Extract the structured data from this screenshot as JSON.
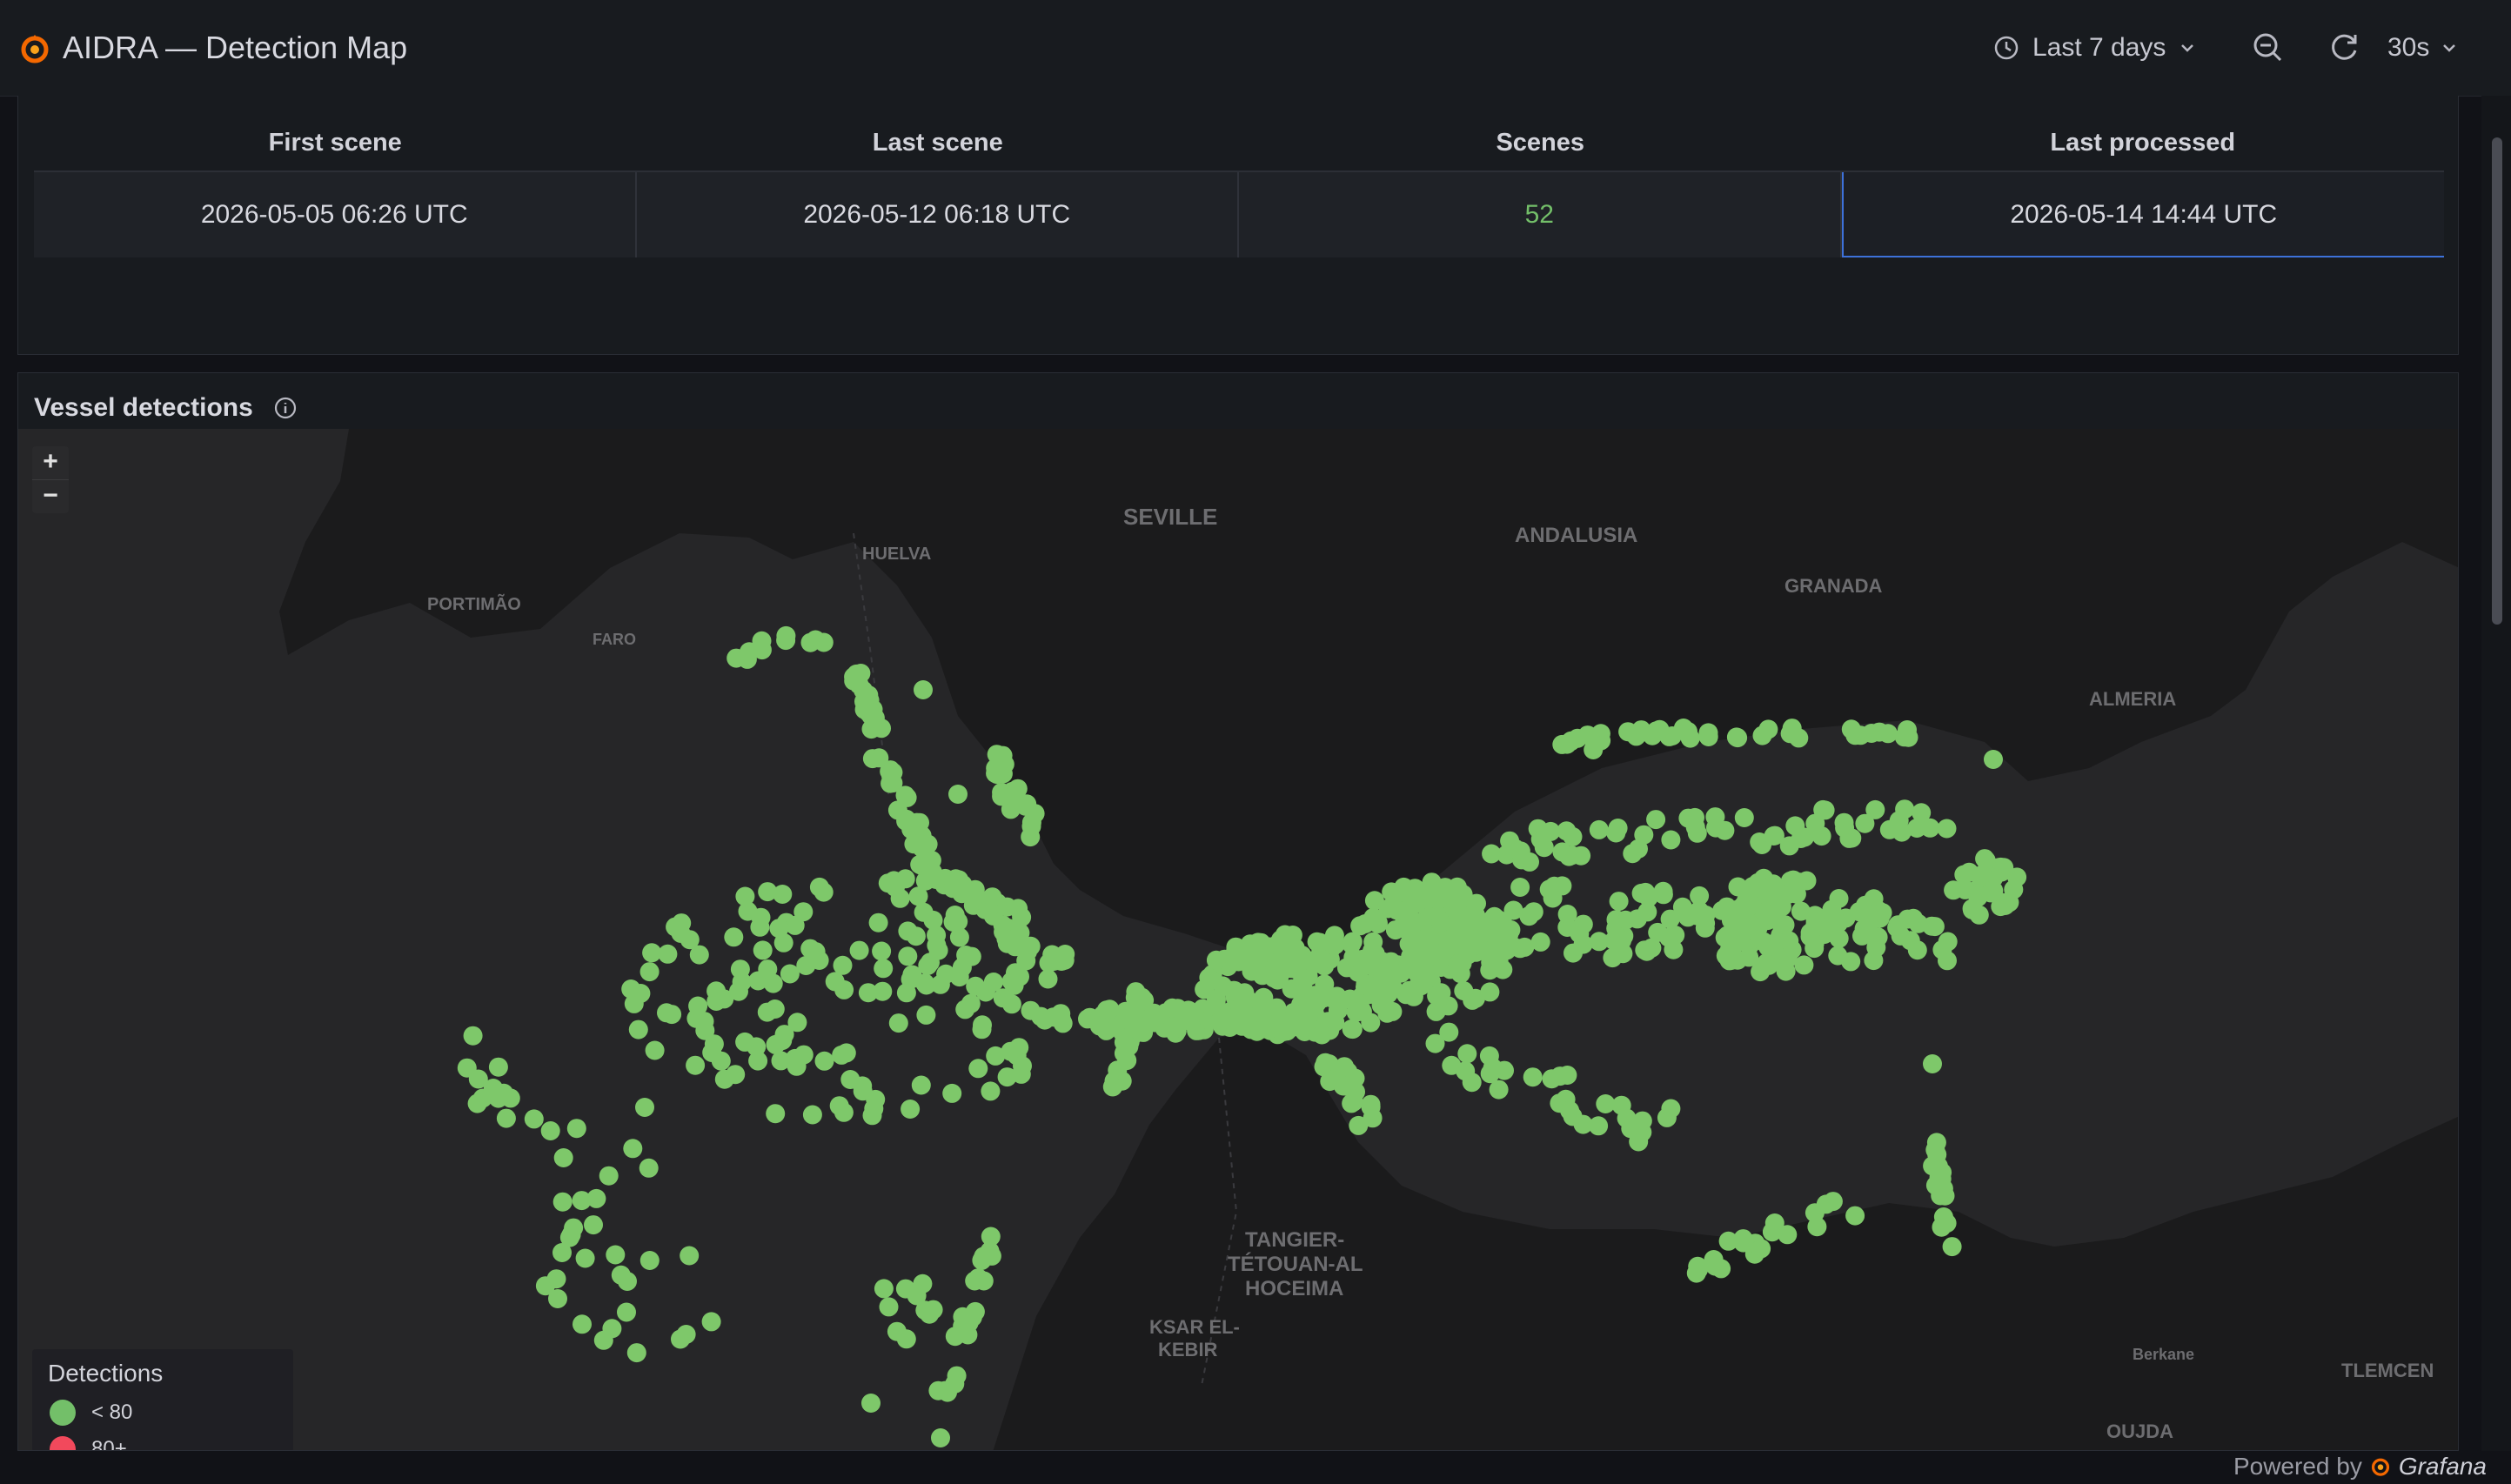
{
  "header": {
    "title": "AIDRA — Detection Map",
    "time_range": "Last 7 days",
    "refresh_interval": "30s"
  },
  "stats": {
    "columns": [
      "First scene",
      "Last scene",
      "Scenes",
      "Last processed"
    ],
    "values": [
      "2026-05-05 06:26 UTC",
      "2026-05-12 06:18 UTC",
      "52",
      "2026-05-14 14:44 UTC"
    ]
  },
  "map_panel": {
    "title": "Vessel detections",
    "zoom_in": "+",
    "zoom_out": "−",
    "place_labels": [
      "SEVILLE",
      "ANDALUSIA",
      "GRANADA",
      "ALMERIA",
      "PORTIMÃO",
      "FARO",
      "HUELVA",
      "TANGIER-TETOUAN-AL HOCEIMA",
      "KSAR EL-KEBIR",
      "TLEMCEN",
      "OUJDA",
      "Berkane"
    ],
    "legend": {
      "title": "Detections",
      "items": [
        {
          "label": "< 80",
          "color": "#73bf69"
        },
        {
          "label": "80+",
          "color": "#f2495c"
        }
      ]
    },
    "marker_color": "#7ec86a"
  },
  "footer": {
    "powered_by": "Powered by",
    "brand": "Grafana"
  }
}
